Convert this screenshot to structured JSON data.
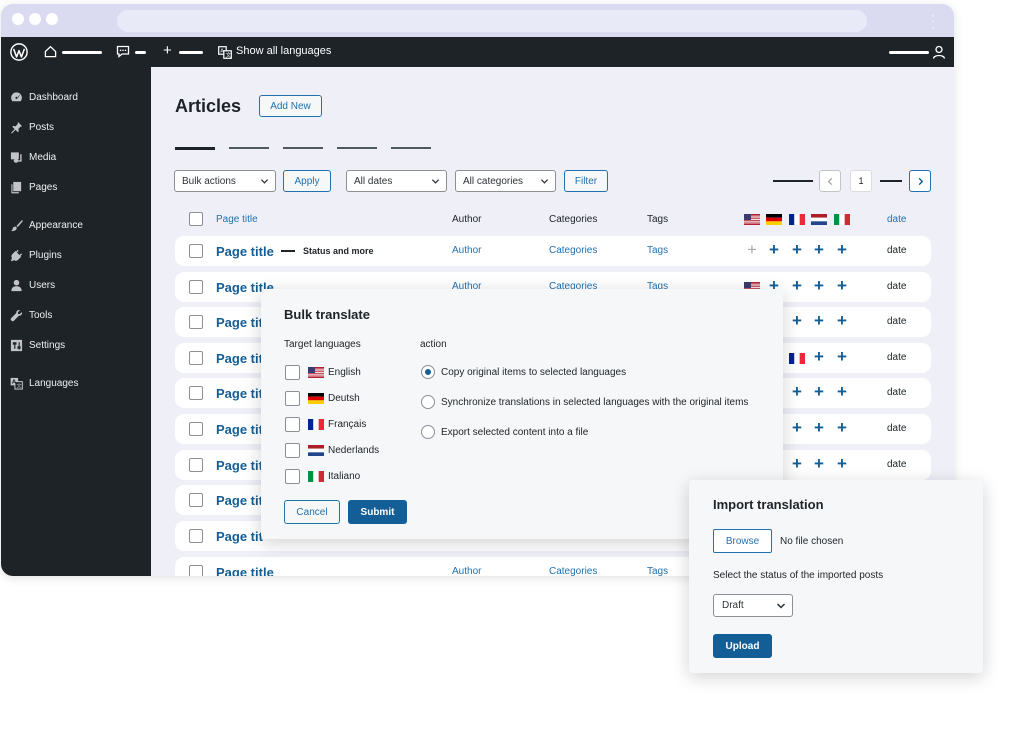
{
  "admin_bar": {
    "language_switch_label": "Show all languages"
  },
  "sidebar": {
    "items": [
      {
        "label": "Dashboard",
        "icon": "dashboard-icon"
      },
      {
        "label": "Posts",
        "icon": "pin-icon"
      },
      {
        "label": "Media",
        "icon": "media-icon"
      },
      {
        "label": "Pages",
        "icon": "pages-icon"
      },
      {
        "label": "Appearance",
        "icon": "brush-icon"
      },
      {
        "label": "Plugins",
        "icon": "plug-icon"
      },
      {
        "label": "Users",
        "icon": "user-icon"
      },
      {
        "label": "Tools",
        "icon": "wrench-icon"
      },
      {
        "label": "Settings",
        "icon": "settings-icon"
      },
      {
        "label": "Languages",
        "icon": "translate-icon"
      }
    ]
  },
  "main": {
    "title": "Articles",
    "add_new_label": "Add New",
    "bulk_actions": "Bulk actions",
    "apply_label": "Apply",
    "dates_filter": "All dates",
    "categories_filter": "All categories",
    "filter_label": "Filter",
    "current_page": "1"
  },
  "table": {
    "headers": {
      "title": "Page title",
      "author": "Author",
      "categories": "Categories",
      "tags": "Tags",
      "date": "date"
    },
    "rows": [
      {
        "title": "Page title",
        "status": "Status and more",
        "author": "Author",
        "categories": "Categories",
        "tags": "Tags",
        "date": "date"
      },
      {
        "title": "Page title",
        "author": "Author",
        "categories": "Categories",
        "tags": "Tags",
        "date": "date"
      },
      {
        "title": "Page tit",
        "date": "date"
      },
      {
        "title": "Page tit",
        "date": "date"
      },
      {
        "title": "Page tit",
        "date": "date"
      },
      {
        "title": "Page tit",
        "date": "date"
      },
      {
        "title": "Page tit",
        "date": "date"
      },
      {
        "title": "Page tit"
      },
      {
        "title": "Page tit"
      },
      {
        "title": "Page title",
        "author": "Author",
        "categories": "Categories",
        "tags": "Tags"
      }
    ]
  },
  "bulk_translate": {
    "title": "Bulk translate",
    "target_languages_label": "Target languages",
    "action_label": "action",
    "languages": [
      "English",
      "Deutsh",
      "Français",
      "Nederlands",
      "Italiano"
    ],
    "actions": [
      "Copy original items to selected languages",
      "Synchronize translations in selected languages with the original items",
      "Export selected content into a file"
    ],
    "cancel_label": "Cancel",
    "submit_label": "Submit"
  },
  "import_translation": {
    "title": "Import translation",
    "browse_label": "Browse",
    "file_status": "No file chosen",
    "status_prompt": "Select the status of the imported posts",
    "status_value": "Draft",
    "upload_label": "Upload"
  },
  "colors": {
    "accent": "#135e96",
    "link": "#2271b1",
    "dark": "#1d2327",
    "background": "#efeff8"
  }
}
